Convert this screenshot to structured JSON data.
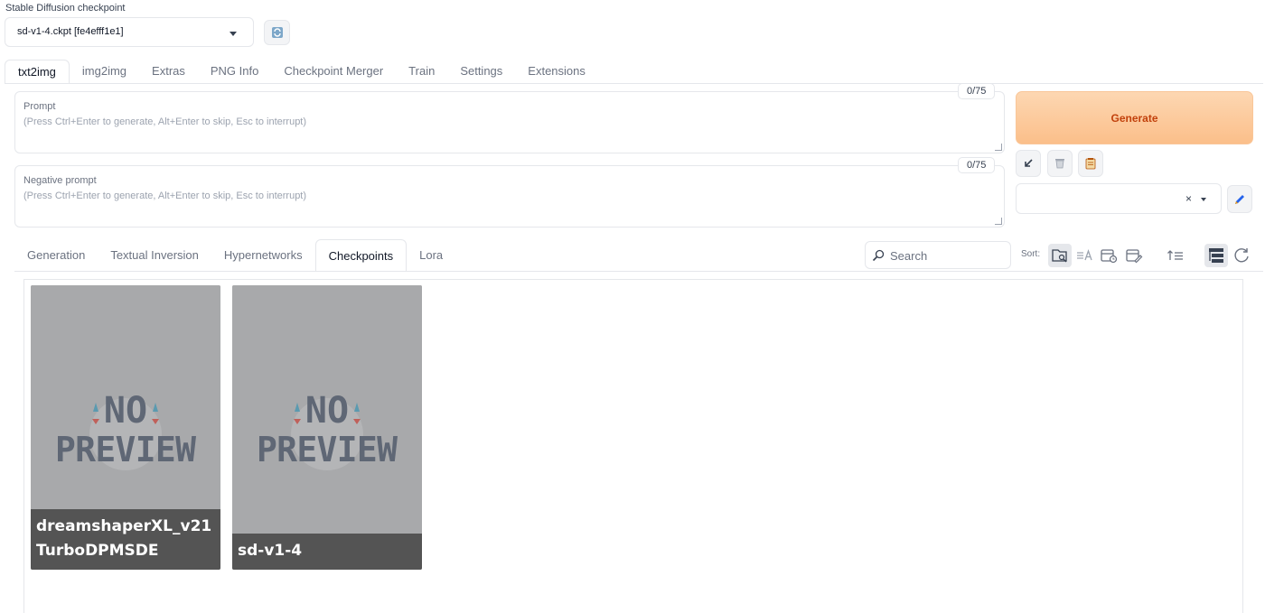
{
  "checkpoint": {
    "label": "Stable Diffusion checkpoint",
    "value": "sd-v1-4.ckpt [fe4efff1e1]"
  },
  "main_tabs": [
    {
      "label": "txt2img",
      "active": true
    },
    {
      "label": "img2img",
      "active": false
    },
    {
      "label": "Extras",
      "active": false
    },
    {
      "label": "PNG Info",
      "active": false
    },
    {
      "label": "Checkpoint Merger",
      "active": false
    },
    {
      "label": "Train",
      "active": false
    },
    {
      "label": "Settings",
      "active": false
    },
    {
      "label": "Extensions",
      "active": false
    }
  ],
  "prompt": {
    "label": "Prompt",
    "placeholder": "(Press Ctrl+Enter to generate, Alt+Enter to skip, Esc to interrupt)",
    "token_count": "0/75"
  },
  "negative_prompt": {
    "label": "Negative prompt",
    "placeholder": "(Press Ctrl+Enter to generate, Alt+Enter to skip, Esc to interrupt)",
    "token_count": "0/75"
  },
  "generate": {
    "label": "Generate"
  },
  "style": {
    "clear_glyph": "×"
  },
  "network_tabs": [
    {
      "label": "Generation",
      "active": false
    },
    {
      "label": "Textual Inversion",
      "active": false
    },
    {
      "label": "Hypernetworks",
      "active": false
    },
    {
      "label": "Checkpoints",
      "active": true
    },
    {
      "label": "Lora",
      "active": false
    }
  ],
  "search": {
    "placeholder": "Search"
  },
  "sort": {
    "label": "Sort:",
    "options": [
      "path-icon",
      "name-icon",
      "date-created-icon",
      "date-modified-icon"
    ],
    "active": "path-icon"
  },
  "cards": [
    {
      "name": "dreamshaperXL_v21TurboDPMSDE",
      "preview_text_1": "NO",
      "preview_text_2": "PREVIEW"
    },
    {
      "name": "sd-v1-4",
      "preview_text_1": "NO",
      "preview_text_2": "PREVIEW"
    }
  ],
  "colors": {
    "generate_text": "#c2410c",
    "generate_bg": "#fbc99b",
    "card_bg": "#a8a9ab",
    "preview_text": "#5f6775"
  }
}
